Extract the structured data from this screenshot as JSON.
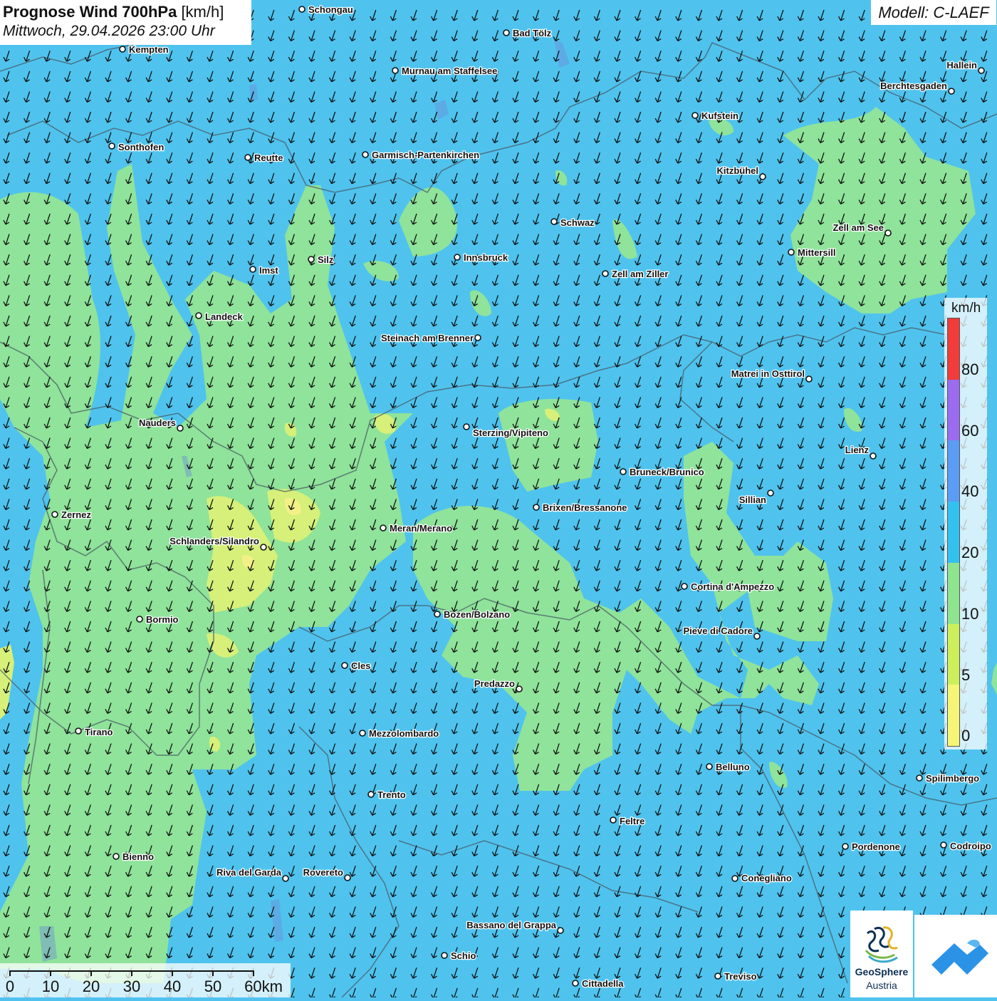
{
  "title": {
    "main": "Prognose Wind 700hPa",
    "unit": "[km/h]",
    "datetime": "Mittwoch, 29.04.2026 23:00 Uhr"
  },
  "model": "Modell: C-LAEF",
  "colors": {
    "background_20_40": "#4fc3ee",
    "band_10_20": "#8fe39a",
    "band_5_10": "#d6f07a",
    "band_0_5": "#f7f47e",
    "arrow": "#111111"
  },
  "wind_field": {
    "direction": "from north-north-east, arrows pointing to south-south-west"
  },
  "legend": {
    "unit": "km/h",
    "ticks": [
      "80",
      "60",
      "40",
      "20",
      "10",
      "5",
      "0"
    ],
    "segments": [
      {
        "from": 80,
        "color": "#f23b3b"
      },
      {
        "from": 60,
        "color": "#9b6cf0"
      },
      {
        "from": 40,
        "color": "#5b9cf4"
      },
      {
        "from": 20,
        "color": "#33c2f0"
      },
      {
        "from": 10,
        "color": "#8fe48f"
      },
      {
        "from": 5,
        "color": "#cdf05a"
      },
      {
        "from": 0,
        "color": "#f7f576"
      }
    ]
  },
  "scale_bar": {
    "labels": [
      "0",
      "10",
      "20",
      "30",
      "40",
      "50",
      "60km"
    ]
  },
  "logo": {
    "line1": "GeoSphere",
    "line2": "Austria"
  },
  "cities": [
    {
      "name": "Schongau"
    },
    {
      "name": "Bad Tölz"
    },
    {
      "name": "Kempten"
    },
    {
      "name": "Murnau am Staffelsee"
    },
    {
      "name": "Hallein"
    },
    {
      "name": "Berchtesgaden"
    },
    {
      "name": "Kufstein"
    },
    {
      "name": "Sonthofen"
    },
    {
      "name": "Reutte"
    },
    {
      "name": "Garmisch-Partenkirchen"
    },
    {
      "name": "Kitzbühel"
    },
    {
      "name": "Schwaz"
    },
    {
      "name": "Zell am See"
    },
    {
      "name": "Mittersill"
    },
    {
      "name": "Innsbruck"
    },
    {
      "name": "Imst"
    },
    {
      "name": "Silz"
    },
    {
      "name": "Zell am Ziller"
    },
    {
      "name": "Landeck"
    },
    {
      "name": "Steinach am Brenner"
    },
    {
      "name": "Matrei in Osttirol"
    },
    {
      "name": "Nauders"
    },
    {
      "name": "Sterzing/Vipiteno"
    },
    {
      "name": "Lienz"
    },
    {
      "name": "Bruneck/Brunico"
    },
    {
      "name": "Sillian"
    },
    {
      "name": "Zernez"
    },
    {
      "name": "Brixen/Bressanone"
    },
    {
      "name": "Meran/Merano"
    },
    {
      "name": "Schlanders/Silandro"
    },
    {
      "name": "Cortina d'Ampezzo"
    },
    {
      "name": "Bozen/Bolzano"
    },
    {
      "name": "Bormio"
    },
    {
      "name": "Pieve di Cadore"
    },
    {
      "name": "Cles"
    },
    {
      "name": "Predazzo"
    },
    {
      "name": "Tirano"
    },
    {
      "name": "Mezzolombardo"
    },
    {
      "name": "Belluno"
    },
    {
      "name": "Spilimbergo"
    },
    {
      "name": "Trento"
    },
    {
      "name": "Feltre"
    },
    {
      "name": "Pordenone"
    },
    {
      "name": "Codroipo"
    },
    {
      "name": "Bienno"
    },
    {
      "name": "Riva del Garda"
    },
    {
      "name": "Rovereto"
    },
    {
      "name": "Conegliano"
    },
    {
      "name": "Bassano del Grappa"
    },
    {
      "name": "Schio"
    },
    {
      "name": "Treviso"
    },
    {
      "name": "Cittadella"
    }
  ]
}
